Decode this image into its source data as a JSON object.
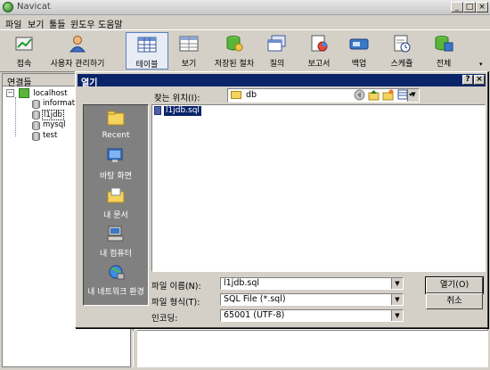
{
  "app": {
    "title": "Navicat"
  },
  "window_controls": {
    "minimize": "_",
    "maximize": "□",
    "close": "×"
  },
  "menubar": [
    {
      "label": "파일"
    },
    {
      "label": "보기"
    },
    {
      "label": "툴들"
    },
    {
      "label": "윈도우"
    },
    {
      "label": "도움말"
    }
  ],
  "toolbar": [
    {
      "label": "접속",
      "icon": "connect-icon"
    },
    {
      "label": "사용자 관리하기",
      "icon": "user-manager-icon"
    },
    {
      "label": "테이블",
      "icon": "table-icon",
      "active": true
    },
    {
      "label": "보기",
      "icon": "view-icon"
    },
    {
      "label": "저장된 절차",
      "icon": "procedure-icon"
    },
    {
      "label": "질의",
      "icon": "query-icon"
    },
    {
      "label": "보고서",
      "icon": "report-icon"
    },
    {
      "label": "백업",
      "icon": "backup-icon"
    },
    {
      "label": "스케쥴",
      "icon": "schedule-icon"
    },
    {
      "label": "전체",
      "icon": "all-icon"
    }
  ],
  "connections": {
    "header": "연결들",
    "server": "localhost",
    "databases": [
      "informatio",
      "l1jdb",
      "mysql",
      "test"
    ],
    "selected": "l1jdb"
  },
  "dialog": {
    "title": "열기",
    "help": "?",
    "close": "×",
    "look_in_label": "찾는 위치(I):",
    "look_in_value": "db",
    "places": [
      "Recent",
      "바탕 화면",
      "내 문서",
      "내 컴퓨터",
      "내 네트워크 환경"
    ],
    "files": [
      {
        "name": "l1jdb.sql",
        "selected": true
      }
    ],
    "file_name_label": "파일 이름(N):",
    "file_name_value": "l1jdb.sql",
    "file_type_label": "파일 형식(T):",
    "file_type_value": "SQL File (*.sql)",
    "encoding_label": "인코딩:",
    "encoding_value": "65001 (UTF-8)",
    "open_button": "열기(O)",
    "cancel_button": "취소"
  }
}
